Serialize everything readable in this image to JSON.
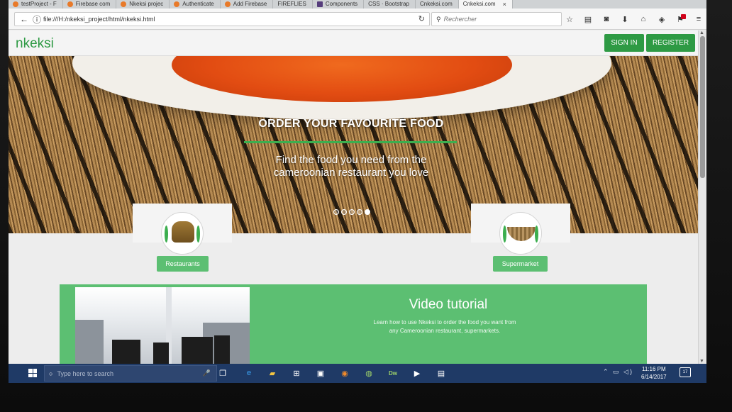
{
  "browser": {
    "tabs": [
      {
        "label": "testProject - F",
        "active": false
      },
      {
        "label": "Firebase com",
        "active": false
      },
      {
        "label": "Nkeksi projec",
        "active": false
      },
      {
        "label": "Authenticate",
        "active": false
      },
      {
        "label": "Add Firebase",
        "active": false
      },
      {
        "label": "FIREFLIES",
        "active": false
      },
      {
        "label": "Components",
        "active": false
      },
      {
        "label": "CSS · Bootstrap",
        "active": false
      },
      {
        "label": "Cnkeksi.com",
        "active": false
      },
      {
        "label": "Cnkeksi.com",
        "active": true
      }
    ],
    "url": "file:///H:/nkeksi_project/html/nkeksi.html",
    "search_placeholder": "Rechercher",
    "accent": "#e87a2a"
  },
  "site": {
    "brand": "nkeksi",
    "signin_label": "SIGN IN",
    "register_label": "REGISTER",
    "brand_color": "#2e9a44"
  },
  "hero": {
    "title": "ORDER YOUR FAVOURITE FOOD",
    "subtitle_line1": "Find the food you need from the",
    "subtitle_line2": "cameroonian restaurant you love",
    "slide_count": 5,
    "active_slide": 5
  },
  "categories": [
    {
      "label": "Restaurants",
      "icon": "food-pot-icon"
    },
    {
      "label": "Supermarket",
      "icon": "basket-icon"
    }
  ],
  "video": {
    "title": "Video tutorial",
    "description": "Learn how to use Nkeksi to order the food you want from any Cameroonian restaurant, supermarkets."
  },
  "taskbar": {
    "search_placeholder": "Type here to search",
    "time": "11:16 PM",
    "date": "6/14/2017",
    "notification_count": "17",
    "color": "#1f3a66"
  }
}
